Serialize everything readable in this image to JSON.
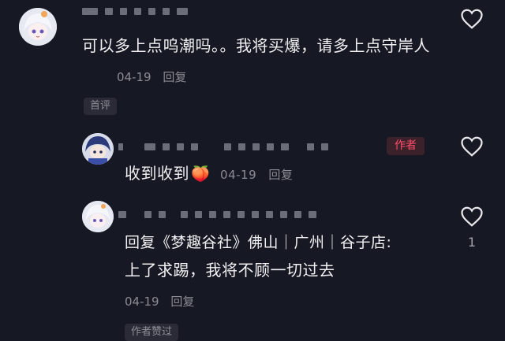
{
  "comments": [
    {
      "text": "可以多上点呜潮吗。。我将买爆，请多上点守岸人",
      "time": "04-19",
      "reply_label": "回复",
      "tag": "首评",
      "avatar_icon": "anime-girl-avatar-icon"
    },
    {
      "text": "收到收到",
      "emoji": "🍑",
      "time": "04-19",
      "reply_label": "回复",
      "badge": "作者",
      "avatar_icon": "anime-boy-avatar-icon"
    },
    {
      "reply_prefix": "回复",
      "reply_target": "《梦趣谷社》佛山｜广州｜谷子店:",
      "text": "上了求踢，我将不顾一切过去",
      "time": "04-19",
      "reply_label": "回复",
      "tag": "作者赞过",
      "like_count": "1",
      "avatar_icon": "anime-girl-avatar-icon"
    }
  ],
  "colors": {
    "background": "#161823",
    "text": "#f1f1f3",
    "muted": "#8a8b93",
    "author_badge": "#ff4d6b"
  }
}
